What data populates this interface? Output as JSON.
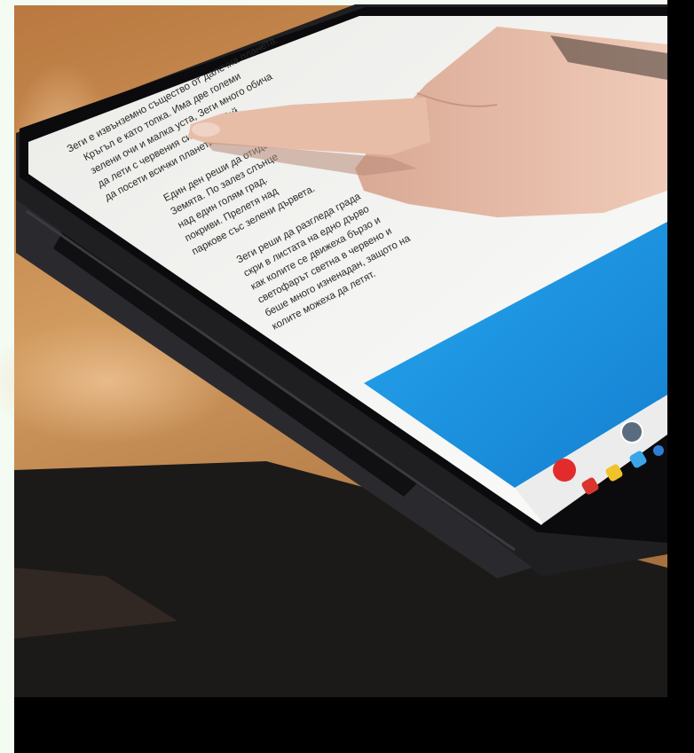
{
  "photo": {
    "subject": "tablet-in-case-finger-touching-screen",
    "colors": {
      "border": "#f3fbf2",
      "table": "#c98e52",
      "case": "#1f1f22",
      "screen_text": "#f2f2f0",
      "screen_blue": "#1f9be6",
      "dock": "#eeeeee",
      "skin": "#e6bca6",
      "letterbox": "#000000"
    }
  },
  "tablet": {
    "paragraph_1": [
      "Зеги е извънземно същество от далечна планета.",
      "Кръгъл е като топка. Има две големи",
      "зелени очи и малка уста, Зеги много обича",
      "да лети с червения си кораб. Той",
      "да посети всички планети."
    ],
    "paragraph_2": [
      "Един ден реши да отиде до",
      "Земята. По залез слънце",
      "над един голям град.",
      "покриви. Прелетя над",
      "паркове със зелени дървета."
    ],
    "paragraph_3": [
      "Зеги реши да разгледа града",
      "скри в листата на едно дърво",
      "как колите се движеха бързо и",
      "светофарът светна в червено и",
      "беше много изненадан, защото на",
      "колите можеха да летят."
    ],
    "dock_icons": [
      "red-app-icon",
      "red-app-icon",
      "yellow-app-icon",
      "blue-app-icon",
      "blue-app-icon"
    ]
  }
}
